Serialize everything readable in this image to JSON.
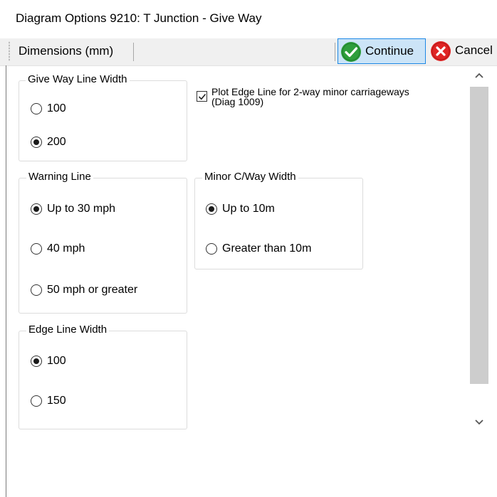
{
  "window": {
    "title": "Diagram Options 9210: T Junction - Give Way"
  },
  "toolbar": {
    "dimensions_label": "Dimensions (mm)",
    "continue_label": "Continue",
    "cancel_label": "Cancel"
  },
  "groups": {
    "give_way": {
      "title": "Give Way Line Width",
      "options": [
        "100",
        "200"
      ],
      "selected": "200"
    },
    "warning": {
      "title": "Warning Line",
      "options": [
        "Up to 30 mph",
        "40 mph",
        "50 mph or greater"
      ],
      "selected": "Up to 30 mph"
    },
    "edge": {
      "title": "Edge Line Width",
      "options": [
        "100",
        "150"
      ],
      "selected": "100"
    },
    "minor": {
      "title": "Minor C/Way Width",
      "options": [
        "Up to 10m",
        "Greater than 10m"
      ],
      "selected": "Up to 10m"
    }
  },
  "checkbox": {
    "label_line1": "Plot Edge Line for 2-way minor carriageways",
    "label_line2": "(Diag 1009)",
    "checked": true
  },
  "icons": {
    "continue": "check-circle-icon",
    "cancel": "x-circle-icon"
  },
  "colors": {
    "continue_green": "#2e9e3c",
    "cancel_red": "#e02424",
    "selected_button_bg": "#cce4f7",
    "selected_button_border": "#1e88e5"
  }
}
